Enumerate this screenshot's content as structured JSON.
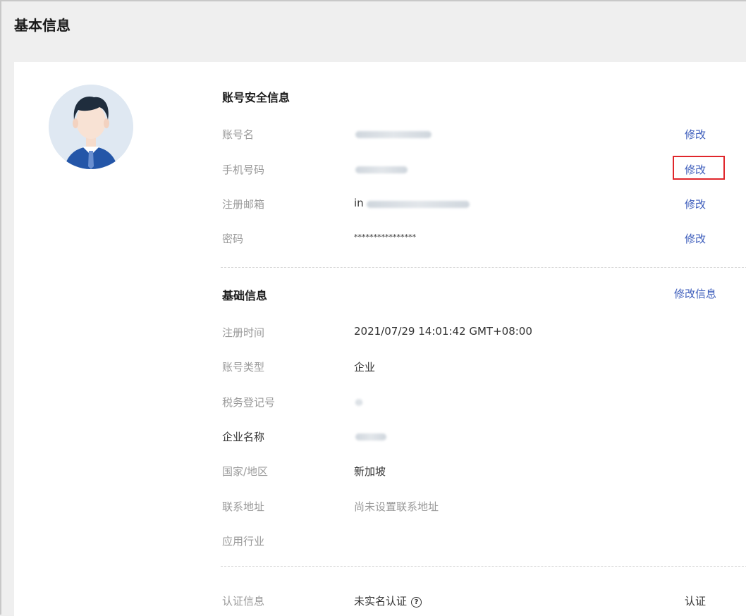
{
  "header": {
    "title": "基本信息"
  },
  "security": {
    "title": "账号安全信息",
    "rows": [
      {
        "label": "账号名",
        "value": "",
        "action": "修改"
      },
      {
        "label": "手机号码",
        "value": "",
        "action": "修改"
      },
      {
        "label": "注册邮箱",
        "value": "in",
        "action": "修改"
      },
      {
        "label": "密码",
        "value": "****************",
        "action": "修改"
      }
    ]
  },
  "basic": {
    "title": "基础信息",
    "edit_action": "修改信息",
    "rows": [
      {
        "label": "注册时间",
        "value": "2021/07/29 14:01:42 GMT+08:00"
      },
      {
        "label": "账号类型",
        "value": "企业"
      },
      {
        "label": "税务登记号",
        "value": ""
      },
      {
        "label": "企业名称",
        "value": ""
      },
      {
        "label": "国家/地区",
        "value": "新加坡"
      },
      {
        "label": "联系地址",
        "value": "尚未设置联系地址"
      },
      {
        "label": "应用行业",
        "value": ""
      }
    ]
  },
  "certification": {
    "label": "认证信息",
    "value": "未实名认证",
    "help_icon": "question-circle-icon",
    "action": "认证"
  },
  "colors": {
    "link": "#3c5cbb",
    "highlight_border": "#e0262b"
  }
}
